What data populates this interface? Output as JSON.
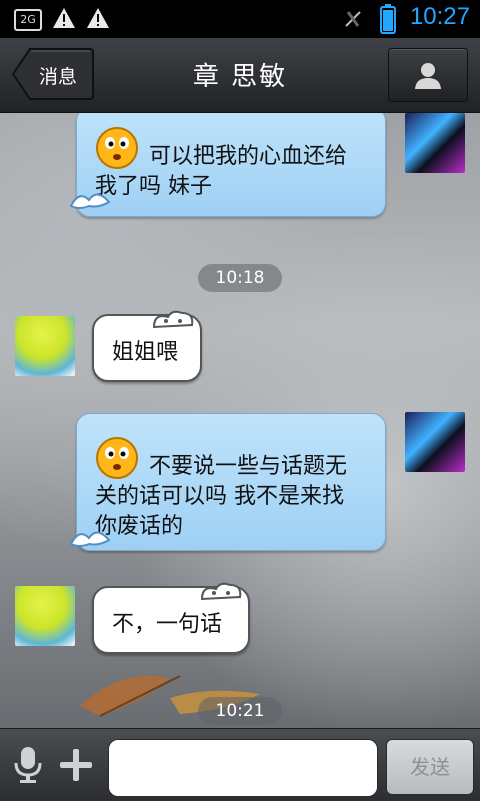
{
  "status_bar": {
    "time": "10:27",
    "sim_badge": "2G",
    "icons": [
      "sim-2g-icon",
      "warning-icon",
      "warning-icon",
      "signal-muted-icon",
      "battery-icon"
    ]
  },
  "header": {
    "back_label": "消息",
    "title": "章  思敏",
    "profile_icon": "person-icon"
  },
  "messages": [
    {
      "side": "right",
      "text": "可以把我的心血还给我了吗 妹子",
      "line1": "可以把我的心血还给",
      "line2": "我了吗 妹子"
    },
    {
      "type": "timestamp",
      "text": "10:18"
    },
    {
      "side": "left",
      "text": "姐姐喂"
    },
    {
      "side": "right",
      "text": "不要说一些与话题无关的话可以吗 我不是来找你废话的",
      "line1": "不要说一些与话题无",
      "line2": "关的话可以吗 我不是来找",
      "line3": "你废话的"
    },
    {
      "side": "left",
      "text": "不，一句话"
    },
    {
      "type": "timestamp",
      "text": "10:21"
    }
  ],
  "input_bar": {
    "mic_icon": "microphone-icon",
    "plus_icon": "plus-icon",
    "input_value": "",
    "send_label": "发送"
  },
  "colors": {
    "accent_time": "#23a7ff",
    "bubble_blue": "#a9d7f6",
    "bubble_white": "#ffffff"
  }
}
